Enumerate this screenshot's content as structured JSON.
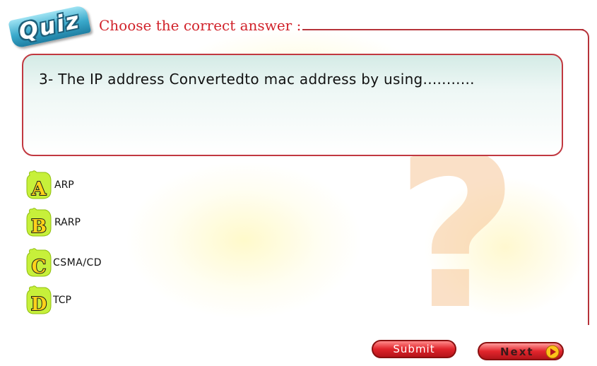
{
  "header": {
    "badge_text": "Quiz",
    "instruction": "Choose the correct answer :"
  },
  "question": {
    "text": "3- The IP address Convertedto mac address by using..........."
  },
  "options": [
    {
      "letter": "A",
      "label": "ARP"
    },
    {
      "letter": "B",
      "label": "RARP"
    },
    {
      "letter": "C",
      "label": "CSMA/CD"
    },
    {
      "letter": "D",
      "label": "TCP"
    }
  ],
  "buttons": {
    "submit_label": "Submit",
    "next_label": "Next"
  },
  "decor": {
    "background_symbol": "?"
  },
  "colors": {
    "accent_red": "#d1222a",
    "badge_blue": "#3aa9cb",
    "option_icon_green": "#c7f03a",
    "option_letter_yellow": "#ffd21a"
  },
  "icons": {
    "option_icon": "letter-badge-icon",
    "next_arrow": "play-arrow-icon"
  }
}
